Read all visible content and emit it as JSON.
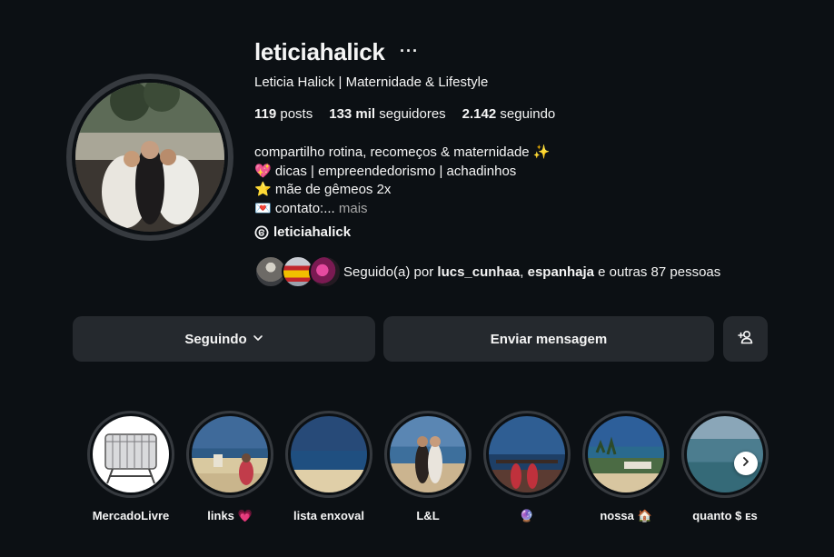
{
  "profile": {
    "username": "leticiahalick",
    "more_icon": "···",
    "full_name": "Leticia Halick | Maternidade & Lifestyle",
    "stats": {
      "posts_count": "119",
      "posts_label": "posts",
      "followers_count": "133 mil",
      "followers_label": "seguidores",
      "following_count": "2.142",
      "following_label": "seguindo"
    },
    "bio": {
      "line1": "compartilho rotina, recomeços & maternidade ✨",
      "line2": "💖 dicas | empreendedorismo | achadinhos",
      "line3": "⭐ mãe de gêmeos 2x",
      "line4": "💌 contato:...",
      "more_label": " mais"
    },
    "threads_handle": "leticiahalick",
    "followed_by": {
      "prefix": "Seguido(a) por ",
      "user1": "lucs_cunhaa",
      "separator": ", ",
      "user2": "espanhaja",
      "suffix": " e outras 87 pessoas"
    }
  },
  "actions": {
    "following_label": "Seguindo",
    "message_label": "Enviar mensagem",
    "add_user_icon": "person-add-icon"
  },
  "highlights": [
    {
      "label": "MercadoLivre"
    },
    {
      "label": "links 💗"
    },
    {
      "label": "lista enxoval"
    },
    {
      "label": "L&L"
    },
    {
      "label": "🔮"
    },
    {
      "label": "nossa 🏠"
    },
    {
      "label": "quanto $ ᴇs"
    }
  ],
  "colors": {
    "background": "#0c1014",
    "button": "#25292e",
    "ring": "#363a3f",
    "muted_text": "#a8a8a8"
  }
}
